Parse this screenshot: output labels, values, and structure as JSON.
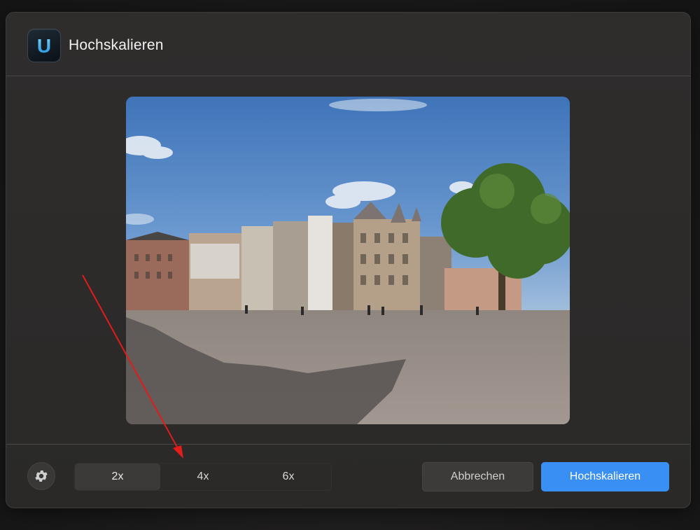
{
  "dialog": {
    "title": "Hochskalieren",
    "app_icon": "upscayl-icon",
    "app_icon_letter": "U"
  },
  "preview": {
    "description_icon": "photo-preview"
  },
  "footer": {
    "settings_icon": "gear-icon",
    "scale_options": [
      {
        "label": "2x",
        "selected": true
      },
      {
        "label": "4x",
        "selected": false
      },
      {
        "label": "6x",
        "selected": false
      }
    ],
    "cancel_label": "Abbrechen",
    "confirm_label": "Hochskalieren"
  },
  "colors": {
    "accent": "#3a8ff5",
    "annotation_arrow": "#e21b1b"
  }
}
